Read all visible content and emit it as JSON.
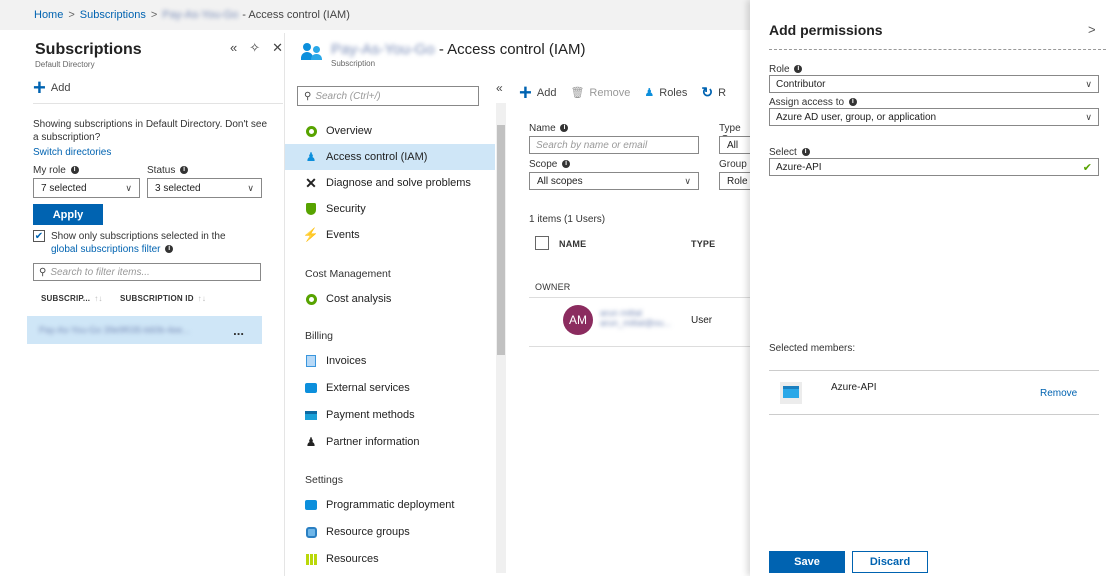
{
  "breadcrumb": {
    "home": "Home",
    "subscriptions": "Subscriptions",
    "subscription_name": "Pay-As-You-Go",
    "current": "- Access control (IAM)",
    "separator": ">"
  },
  "subs_blade": {
    "title": "Subscriptions",
    "subtitle": "Default Directory",
    "add_label": "Add",
    "showing_text": "Showing subscriptions in Default Directory. Don't see a subscription?",
    "switch_link": "Switch directories",
    "my_role_label": "My role",
    "my_role_value": "7 selected",
    "status_label": "Status",
    "status_value": "3 selected",
    "apply_label": "Apply",
    "show_only_text": "Show only subscriptions selected in the",
    "filter_link": "global subscriptions filter",
    "search_placeholder": "Search to filter items...",
    "col_subscription": "SUBSCRIP...",
    "col_subscription_id": "SUBSCRIPTION ID",
    "row_text": "Pay-As-You-Go 39e9f035-b60b-4ee...",
    "row_more": "..."
  },
  "iam_blade": {
    "subscription_name": "Pay-As-You-Go",
    "title": "- Access control (IAM)",
    "subtitle": "Subscription",
    "search_placeholder": "Search (Ctrl+/)",
    "collapse": "«",
    "nav": [
      {
        "label": "Overview"
      },
      {
        "label": "Access control (IAM)"
      },
      {
        "label": "Diagnose and solve problems"
      },
      {
        "label": "Security"
      },
      {
        "label": "Events"
      }
    ],
    "section_cost": "Cost Management",
    "nav_cost": [
      {
        "label": "Cost analysis"
      }
    ],
    "section_billing": "Billing",
    "nav_billing": [
      {
        "label": "Invoices"
      },
      {
        "label": "External services"
      },
      {
        "label": "Payment methods"
      },
      {
        "label": "Partner information"
      }
    ],
    "section_settings": "Settings",
    "nav_settings": [
      {
        "label": "Programmatic deployment"
      },
      {
        "label": "Resource groups"
      },
      {
        "label": "Resources"
      }
    ],
    "cmd_add": "Add",
    "cmd_remove": "Remove",
    "cmd_roles": "Roles",
    "cmd_refresh": "R",
    "name_label": "Name",
    "name_placeholder": "Search by name or email",
    "type_label": "Type",
    "type_value": "All",
    "scope_label": "Scope",
    "scope_value": "All scopes",
    "group_label": "Group",
    "group_value": "Role",
    "items_count": "1 items (1 Users)",
    "col_name": "NAME",
    "col_type": "TYPE",
    "owner_heading": "OWNER",
    "user": {
      "initials": "AM",
      "name": "arun mittal",
      "email": "arun_mittal@ou...",
      "type": "User"
    }
  },
  "permissions": {
    "title": "Add permissions",
    "close": ">",
    "role_label": "Role",
    "role_value": "Contributor",
    "assign_label": "Assign access to",
    "assign_value": "Azure AD user, group, or application",
    "select_label": "Select",
    "select_value": "Azure-API",
    "selected_members_label": "Selected members:",
    "member_name": "Azure-API",
    "member_remove": "Remove",
    "save_label": "Save",
    "discard_label": "Discard"
  },
  "colors": {
    "accent": "#0063b1",
    "selected": "#cfe6f7",
    "avatar": "#8b2c5f",
    "success": "#57a300"
  }
}
